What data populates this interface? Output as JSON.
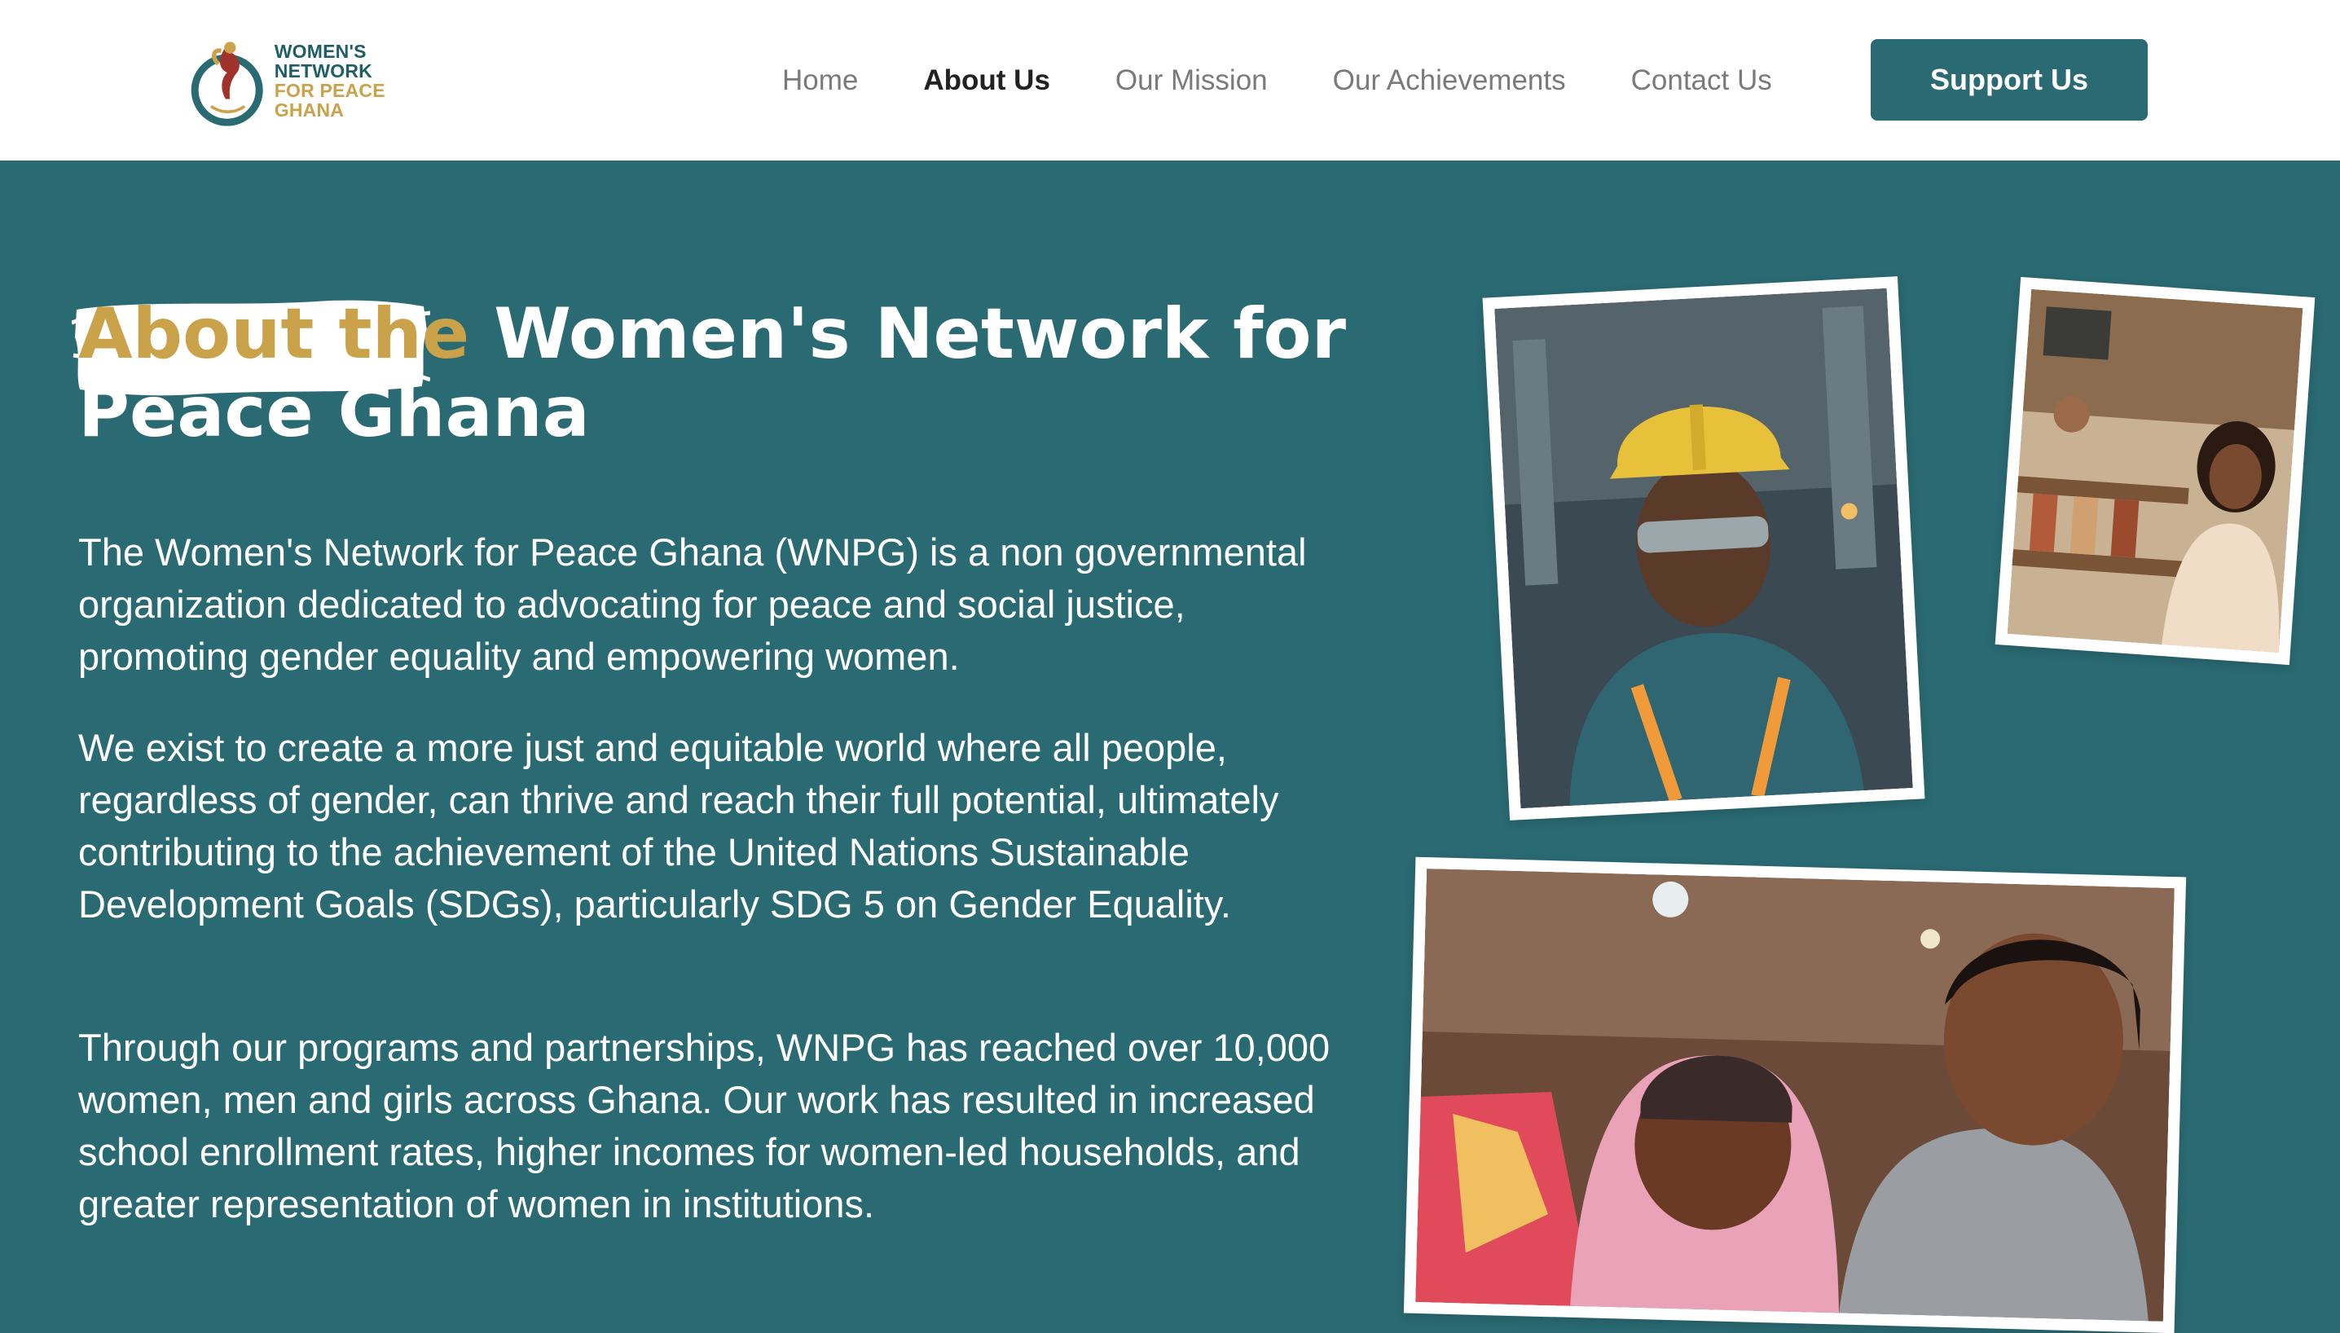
{
  "brand": {
    "line1": "WOMEN'S NETWORK",
    "line2": "FOR PEACE GHANA",
    "ring_text": "WOMEN NETWORK FOR PEACE GHANA",
    "colors": {
      "teal": "#2a6a72",
      "gold": "#c9a24a",
      "red": "#a1322b"
    }
  },
  "nav": {
    "items": [
      {
        "label": "Home",
        "active": false
      },
      {
        "label": "About Us",
        "active": true
      },
      {
        "label": "Our Mission",
        "active": false
      },
      {
        "label": "Our Achievements",
        "active": false
      },
      {
        "label": "Contact Us",
        "active": false
      }
    ],
    "cta": "Support Us"
  },
  "hero": {
    "title_highlight": "About the",
    "title_rest": " Women's Network for Peace Ghana",
    "paragraphs": [
      "The Women's Network for Peace Ghana (WNPG) is a non governmental organization dedicated to advocating for peace and social justice, promoting gender equality and empowering women.",
      "We exist to create a more just and equitable world where all people, regardless of gender, can thrive and reach their full potential, ultimately contributing to the achievement of the United Nations Sustainable Development Goals (SDGs), particularly SDG 5 on Gender Equality.",
      "Through our programs and partnerships, WNPG has reached over 10,000 women, men and girls across Ghana. Our work has resulted in increased school enrollment rates, higher incomes for women-led households, and greater representation of women in institutions."
    ]
  },
  "photos": [
    {
      "icon": "worker-photo"
    },
    {
      "icon": "shop-owner-photo"
    },
    {
      "icon": "women-gift-photo"
    }
  ]
}
